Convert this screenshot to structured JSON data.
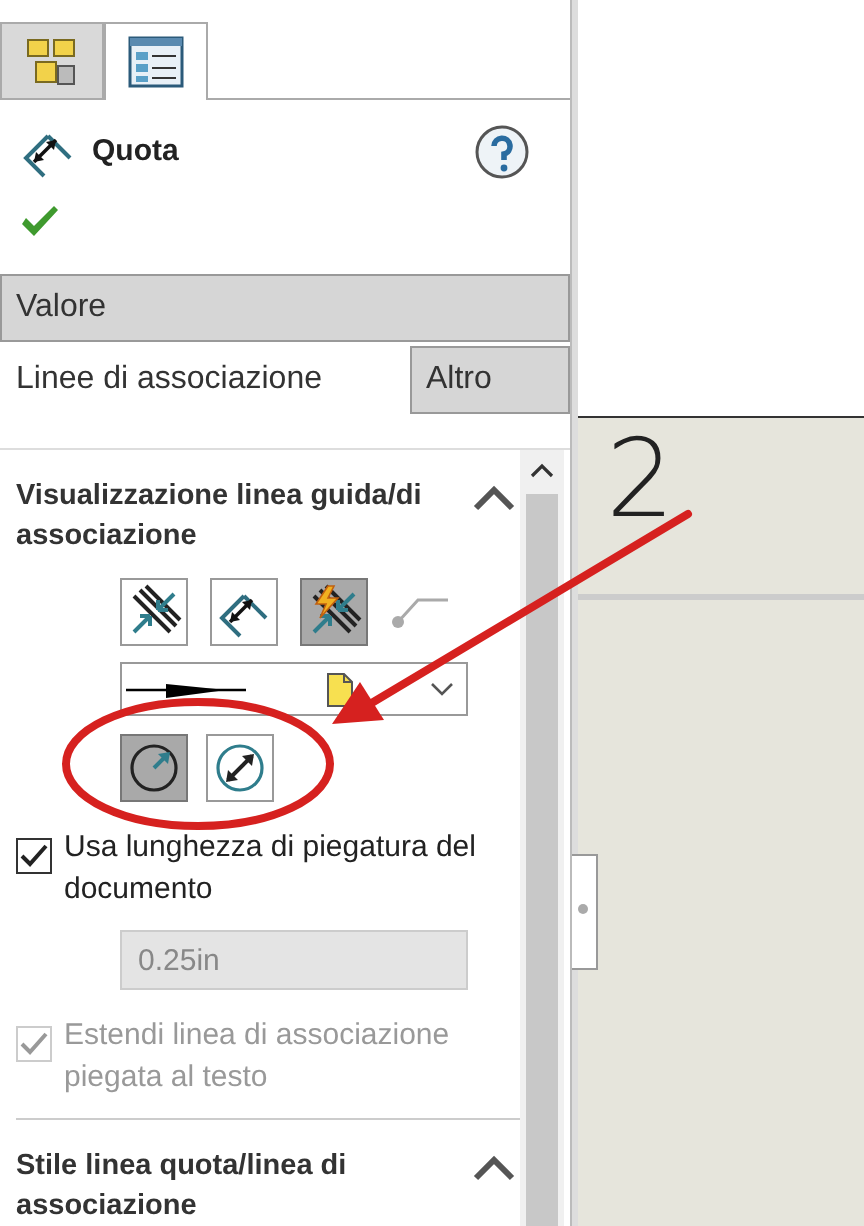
{
  "panel_tabs": [
    {
      "selected": false
    },
    {
      "selected": true
    }
  ],
  "header": {
    "title": "Quota"
  },
  "group_tabs": [
    [
      {
        "label": "Valore",
        "selected": false
      }
    ],
    [
      {
        "label": "Linee di associazione",
        "selected": true
      },
      {
        "label": "Altro",
        "selected": false
      }
    ]
  ],
  "sections": [
    {
      "title": "Visualizzazione linea guida/di associazione",
      "expanded": true,
      "style_buttons": [
        {
          "selected": false
        },
        {
          "selected": false
        },
        {
          "selected": true
        }
      ],
      "bend_buttons": [
        {
          "selected": true
        },
        {
          "selected": false
        }
      ],
      "options": [
        {
          "kind": "checkbox",
          "label": "Usa lunghezza di piegatura del documento",
          "checked": true,
          "disabled": false
        },
        {
          "kind": "field",
          "value": "0.25in",
          "disabled": true
        },
        {
          "kind": "checkbox",
          "label": "Estendi linea di associazione piegata al testo",
          "checked": true,
          "disabled": true
        }
      ]
    },
    {
      "title": "Stile linea quota/linea di associazione",
      "expanded": true
    }
  ],
  "canvas": {
    "text": "2"
  },
  "highlight_ellipse": {
    "color": "#d6211f"
  },
  "pointer_arrow": {
    "color": "#d6211f"
  }
}
